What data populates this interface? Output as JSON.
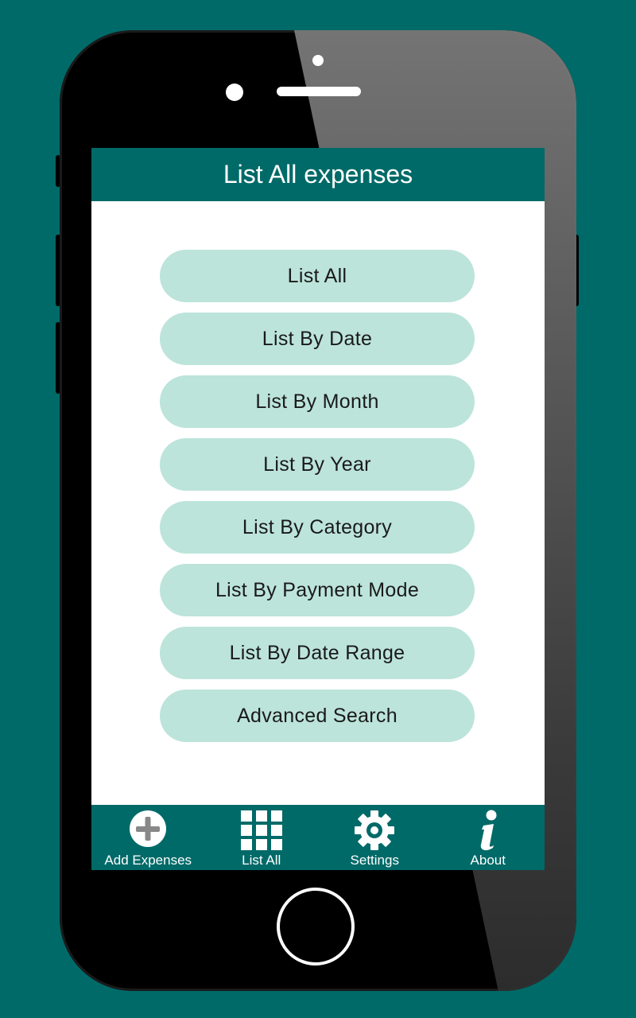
{
  "header": {
    "title": "List All expenses"
  },
  "menu": {
    "items": [
      {
        "label": "List All"
      },
      {
        "label": "List By Date"
      },
      {
        "label": "List By Month"
      },
      {
        "label": "List By Year"
      },
      {
        "label": "List By Category"
      },
      {
        "label": "List By Payment Mode"
      },
      {
        "label": "List By Date Range"
      },
      {
        "label": "Advanced Search"
      }
    ]
  },
  "tabbar": {
    "tabs": [
      {
        "label": "Add Expenses",
        "icon": "plus-circle-icon"
      },
      {
        "label": "List All",
        "icon": "grid-icon"
      },
      {
        "label": "Settings",
        "icon": "gear-icon"
      },
      {
        "label": "About",
        "icon": "info-icon"
      }
    ]
  },
  "colors": {
    "background": "#006a68",
    "header": "#006a68",
    "button": "#bce4da",
    "button_text": "#1a1a1a",
    "header_text": "#ffffff"
  }
}
